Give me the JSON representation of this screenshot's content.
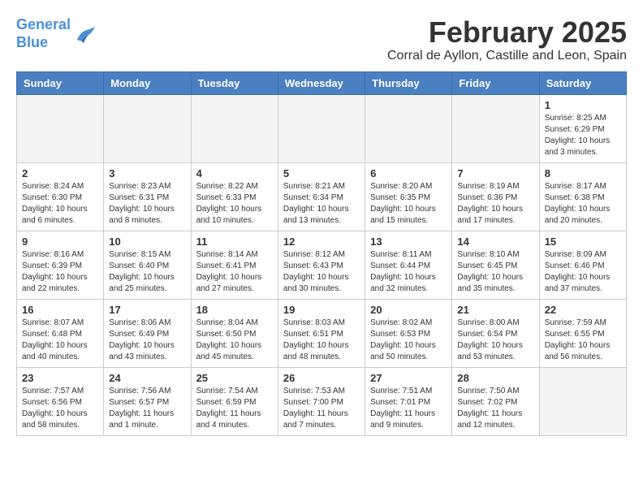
{
  "logo": {
    "line1": "General",
    "line2": "Blue"
  },
  "title": "February 2025",
  "location": "Corral de Ayllon, Castille and Leon, Spain",
  "weekdays": [
    "Sunday",
    "Monday",
    "Tuesday",
    "Wednesday",
    "Thursday",
    "Friday",
    "Saturday"
  ],
  "weeks": [
    [
      {
        "day": "",
        "info": ""
      },
      {
        "day": "",
        "info": ""
      },
      {
        "day": "",
        "info": ""
      },
      {
        "day": "",
        "info": ""
      },
      {
        "day": "",
        "info": ""
      },
      {
        "day": "",
        "info": ""
      },
      {
        "day": "1",
        "info": "Sunrise: 8:25 AM\nSunset: 6:29 PM\nDaylight: 10 hours\nand 3 minutes."
      }
    ],
    [
      {
        "day": "2",
        "info": "Sunrise: 8:24 AM\nSunset: 6:30 PM\nDaylight: 10 hours\nand 6 minutes."
      },
      {
        "day": "3",
        "info": "Sunrise: 8:23 AM\nSunset: 6:31 PM\nDaylight: 10 hours\nand 8 minutes."
      },
      {
        "day": "4",
        "info": "Sunrise: 8:22 AM\nSunset: 6:33 PM\nDaylight: 10 hours\nand 10 minutes."
      },
      {
        "day": "5",
        "info": "Sunrise: 8:21 AM\nSunset: 6:34 PM\nDaylight: 10 hours\nand 13 minutes."
      },
      {
        "day": "6",
        "info": "Sunrise: 8:20 AM\nSunset: 6:35 PM\nDaylight: 10 hours\nand 15 minutes."
      },
      {
        "day": "7",
        "info": "Sunrise: 8:19 AM\nSunset: 6:36 PM\nDaylight: 10 hours\nand 17 minutes."
      },
      {
        "day": "8",
        "info": "Sunrise: 8:17 AM\nSunset: 6:38 PM\nDaylight: 10 hours\nand 20 minutes."
      }
    ],
    [
      {
        "day": "9",
        "info": "Sunrise: 8:16 AM\nSunset: 6:39 PM\nDaylight: 10 hours\nand 22 minutes."
      },
      {
        "day": "10",
        "info": "Sunrise: 8:15 AM\nSunset: 6:40 PM\nDaylight: 10 hours\nand 25 minutes."
      },
      {
        "day": "11",
        "info": "Sunrise: 8:14 AM\nSunset: 6:41 PM\nDaylight: 10 hours\nand 27 minutes."
      },
      {
        "day": "12",
        "info": "Sunrise: 8:12 AM\nSunset: 6:43 PM\nDaylight: 10 hours\nand 30 minutes."
      },
      {
        "day": "13",
        "info": "Sunrise: 8:11 AM\nSunset: 6:44 PM\nDaylight: 10 hours\nand 32 minutes."
      },
      {
        "day": "14",
        "info": "Sunrise: 8:10 AM\nSunset: 6:45 PM\nDaylight: 10 hours\nand 35 minutes."
      },
      {
        "day": "15",
        "info": "Sunrise: 8:09 AM\nSunset: 6:46 PM\nDaylight: 10 hours\nand 37 minutes."
      }
    ],
    [
      {
        "day": "16",
        "info": "Sunrise: 8:07 AM\nSunset: 6:48 PM\nDaylight: 10 hours\nand 40 minutes."
      },
      {
        "day": "17",
        "info": "Sunrise: 8:06 AM\nSunset: 6:49 PM\nDaylight: 10 hours\nand 43 minutes."
      },
      {
        "day": "18",
        "info": "Sunrise: 8:04 AM\nSunset: 6:50 PM\nDaylight: 10 hours\nand 45 minutes."
      },
      {
        "day": "19",
        "info": "Sunrise: 8:03 AM\nSunset: 6:51 PM\nDaylight: 10 hours\nand 48 minutes."
      },
      {
        "day": "20",
        "info": "Sunrise: 8:02 AM\nSunset: 6:53 PM\nDaylight: 10 hours\nand 50 minutes."
      },
      {
        "day": "21",
        "info": "Sunrise: 8:00 AM\nSunset: 6:54 PM\nDaylight: 10 hours\nand 53 minutes."
      },
      {
        "day": "22",
        "info": "Sunrise: 7:59 AM\nSunset: 6:55 PM\nDaylight: 10 hours\nand 56 minutes."
      }
    ],
    [
      {
        "day": "23",
        "info": "Sunrise: 7:57 AM\nSunset: 6:56 PM\nDaylight: 10 hours\nand 58 minutes."
      },
      {
        "day": "24",
        "info": "Sunrise: 7:56 AM\nSunset: 6:57 PM\nDaylight: 11 hours\nand 1 minute."
      },
      {
        "day": "25",
        "info": "Sunrise: 7:54 AM\nSunset: 6:59 PM\nDaylight: 11 hours\nand 4 minutes."
      },
      {
        "day": "26",
        "info": "Sunrise: 7:53 AM\nSunset: 7:00 PM\nDaylight: 11 hours\nand 7 minutes."
      },
      {
        "day": "27",
        "info": "Sunrise: 7:51 AM\nSunset: 7:01 PM\nDaylight: 11 hours\nand 9 minutes."
      },
      {
        "day": "28",
        "info": "Sunrise: 7:50 AM\nSunset: 7:02 PM\nDaylight: 11 hours\nand 12 minutes."
      },
      {
        "day": "",
        "info": ""
      }
    ]
  ]
}
